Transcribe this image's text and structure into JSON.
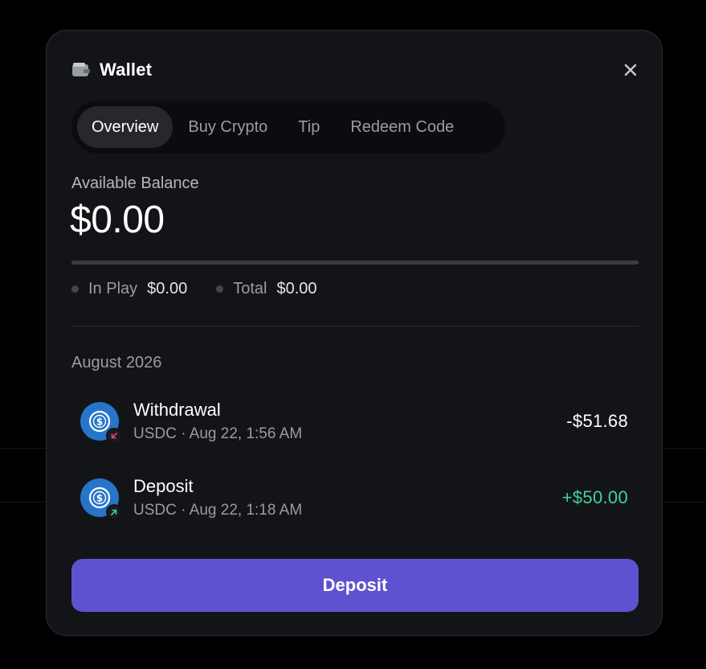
{
  "modal": {
    "title": "Wallet",
    "wallet_icon": "wallet-icon",
    "close_icon": "close-icon"
  },
  "tabs": [
    {
      "label": "Overview",
      "active": true
    },
    {
      "label": "Buy Crypto",
      "active": false
    },
    {
      "label": "Tip",
      "active": false
    },
    {
      "label": "Redeem Code",
      "active": false
    }
  ],
  "balance": {
    "label": "Available Balance",
    "value": "$0.00",
    "progress_fraction": 0
  },
  "stats": [
    {
      "label": "In Play",
      "value": "$0.00"
    },
    {
      "label": "Total",
      "value": "$0.00"
    }
  ],
  "transactions": {
    "month": "August 2026",
    "items": [
      {
        "title": "Withdrawal",
        "subtitle": "USDC · Aug 22, 1:56 AM",
        "amount": "-$51.68",
        "amount_color": "#ffffff",
        "coin_icon": "usdc-icon",
        "direction_icon": "arrow-down-left-icon",
        "direction_color": "#e2467f"
      },
      {
        "title": "Deposit",
        "subtitle": "USDC · Aug 22, 1:18 AM",
        "amount": "+$50.00",
        "amount_color": "#3ed49a",
        "coin_icon": "usdc-icon",
        "direction_icon": "arrow-up-right-icon",
        "direction_color": "#3ed49a"
      }
    ]
  },
  "deposit_button": {
    "label": "Deposit",
    "color": "#5f52d0"
  },
  "colors": {
    "background": "#000000",
    "modal": "#131418",
    "accent": "#5f52d0",
    "positive": "#3ed49a",
    "negative": "#e2467f"
  }
}
